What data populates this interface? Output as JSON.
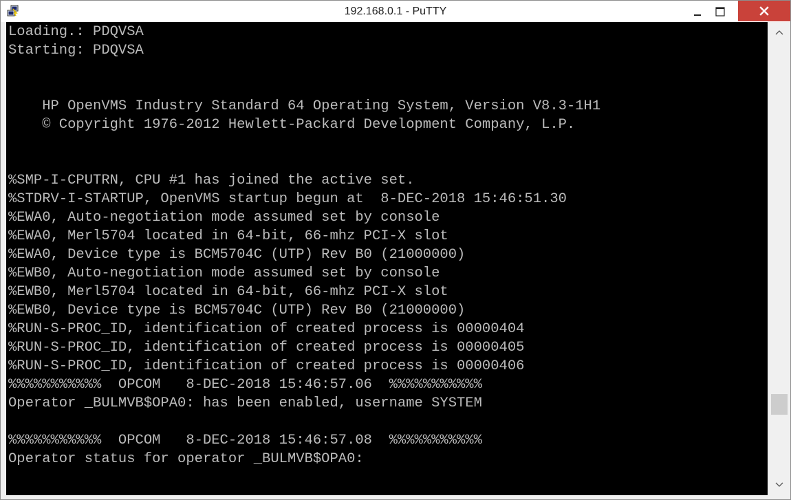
{
  "window": {
    "title": "192.168.0.1 - PuTTY",
    "app_icon": "putty-icon",
    "controls": [
      "minimize-icon",
      "maximize-icon",
      "close-icon"
    ],
    "close_color": "#c9423a"
  },
  "terminal": {
    "background": "#000000",
    "foreground": "#bbbbbb",
    "lines": [
      "Loading.: PDQVSA",
      "Starting: PDQVSA",
      "",
      "",
      "    HP OpenVMS Industry Standard 64 Operating System, Version V8.3-1H1",
      "    © Copyright 1976-2012 Hewlett-Packard Development Company, L.P.",
      "",
      "",
      "%SMP-I-CPUTRN, CPU #1 has joined the active set.",
      "%STDRV-I-STARTUP, OpenVMS startup begun at  8-DEC-2018 15:46:51.30",
      "%EWA0, Auto-negotiation mode assumed set by console",
      "%EWA0, Merl5704 located in 64-bit, 66-mhz PCI-X slot",
      "%EWA0, Device type is BCM5704C (UTP) Rev B0 (21000000)",
      "%EWB0, Auto-negotiation mode assumed set by console",
      "%EWB0, Merl5704 located in 64-bit, 66-mhz PCI-X slot",
      "%EWB0, Device type is BCM5704C (UTP) Rev B0 (21000000)",
      "%RUN-S-PROC_ID, identification of created process is 00000404",
      "%RUN-S-PROC_ID, identification of created process is 00000405",
      "%RUN-S-PROC_ID, identification of created process is 00000406",
      "%%%%%%%%%%%  OPCOM   8-DEC-2018 15:46:57.06  %%%%%%%%%%%",
      "Operator _BULMVB$OPA0: has been enabled, username SYSTEM",
      "",
      "%%%%%%%%%%%  OPCOM   8-DEC-2018 15:46:57.08  %%%%%%%%%%%",
      "Operator status for operator _BULMVB$OPA0:"
    ]
  },
  "scrollbar": {
    "up_icon": "chevron-up-icon",
    "down_icon": "chevron-down-icon",
    "position": 0.86
  }
}
